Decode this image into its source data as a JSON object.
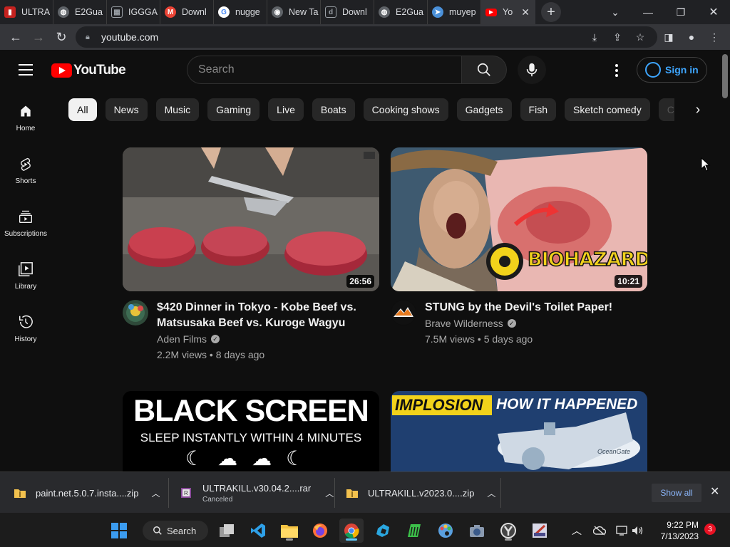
{
  "browser": {
    "tabs": [
      {
        "label": "ULTRA",
        "icon": "pdf-icon",
        "color": "#e8453c"
      },
      {
        "label": "E2Gua",
        "icon": "globe-icon",
        "color": "#5f6368"
      },
      {
        "label": "IGGGA",
        "icon": "igg-icon",
        "color": "#9aa0a6"
      },
      {
        "label": "Downl",
        "icon": "gmail-icon",
        "color": "#ea4335"
      },
      {
        "label": "nugge",
        "icon": "google-icon",
        "color": "#4285f4"
      },
      {
        "label": "New Ta",
        "icon": "chrome-icon",
        "color": "#5f6368"
      },
      {
        "label": "Downl",
        "icon": "download-site-icon",
        "color": "#9aa0a6"
      },
      {
        "label": "E2Gua",
        "icon": "globe-icon",
        "color": "#5f6368"
      },
      {
        "label": "muyep",
        "icon": "muyep-icon",
        "color": "#4a90d9"
      },
      {
        "label": "Yo",
        "icon": "youtube-icon",
        "color": "#ff0000"
      }
    ],
    "url": "youtube.com"
  },
  "youtube": {
    "logo_text": "YouTube",
    "search_placeholder": "Search",
    "sign_in": "Sign in",
    "sidebar": [
      {
        "label": "Home",
        "icon": "home-icon"
      },
      {
        "label": "Shorts",
        "icon": "shorts-icon"
      },
      {
        "label": "Subscriptions",
        "icon": "subscriptions-icon"
      },
      {
        "label": "Library",
        "icon": "library-icon"
      },
      {
        "label": "History",
        "icon": "history-icon"
      }
    ],
    "chips": [
      "All",
      "News",
      "Music",
      "Gaming",
      "Live",
      "Boats",
      "Cooking shows",
      "Gadgets",
      "Fish",
      "Sketch comedy",
      "C"
    ],
    "videos": [
      {
        "title": "$420 Dinner in Tokyo - Kobe Beef vs. Matsusaka Beef vs. Kuroge Wagyu",
        "channel": "Aden Films",
        "stats": "2.2M views • 8 days ago",
        "duration": "26:56"
      },
      {
        "title": "STUNG by the Devil's Toilet Paper!",
        "channel": "Brave Wilderness",
        "stats": "7.5M views • 5 days ago",
        "duration": "10:21",
        "thumb_text": "BIOHAZARD"
      },
      {
        "title": "",
        "thumb_text_1": "BLACK SCREEN",
        "thumb_text_2": "SLEEP INSTANTLY WITHIN 4 MINUTES"
      },
      {
        "title": "",
        "thumb_text_1": "IMPLOSION",
        "thumb_text_2": "HOW IT HAPPENED",
        "thumb_brand": "OceanGate"
      }
    ]
  },
  "downloads": {
    "items": [
      {
        "name": "paint.net.5.0.7.insta....zip",
        "status": ""
      },
      {
        "name": "ULTRAKILL.v30.04.2....rar",
        "status": "Canceled"
      },
      {
        "name": "ULTRAKILL.v2023.0....zip",
        "status": ""
      }
    ],
    "show_all": "Show all"
  },
  "taskbar": {
    "search": "Search",
    "time": "9:22 PM",
    "date": "7/13/2023",
    "notifications": "3"
  }
}
